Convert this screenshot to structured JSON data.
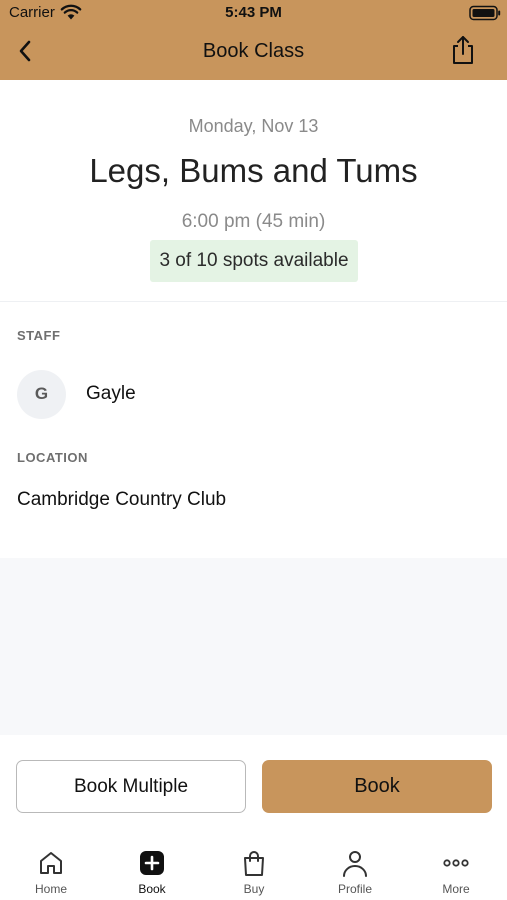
{
  "status_bar": {
    "carrier": "Carrier",
    "time": "5:43 PM"
  },
  "nav": {
    "title": "Book Class"
  },
  "class_info": {
    "date": "Monday, Nov 13",
    "name": "Legs, Bums and Tums",
    "time": "6:00 pm (45 min)",
    "spots": "3 of 10 spots available"
  },
  "staff": {
    "label": "STAFF",
    "initial": "G",
    "name": "Gayle"
  },
  "location": {
    "label": "LOCATION",
    "name": "Cambridge Country Club"
  },
  "actions": {
    "book_multiple": "Book Multiple",
    "book": "Book"
  },
  "tabs": [
    {
      "label": "Home",
      "icon": "home-icon"
    },
    {
      "label": "Book",
      "icon": "plus-square-icon"
    },
    {
      "label": "Buy",
      "icon": "shopping-bag-icon"
    },
    {
      "label": "Profile",
      "icon": "person-icon"
    },
    {
      "label": "More",
      "icon": "more-dots-icon"
    }
  ],
  "colors": {
    "brand": "#c8955c",
    "spots_bg": "#e4f3e4",
    "muted_bg": "#f7f8fa"
  }
}
